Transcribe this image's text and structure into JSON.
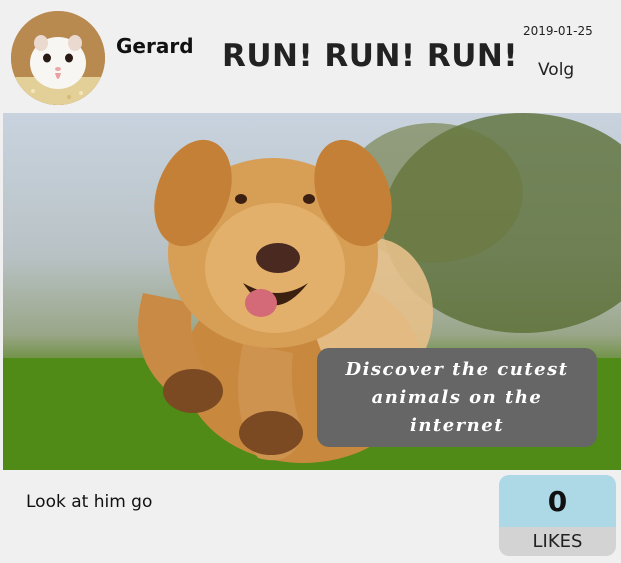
{
  "post": {
    "username": "Gerard",
    "title": "RUN! RUN! RUN!",
    "date": "2019-01-25",
    "follow_label": "Volg",
    "promo_text": "Discover the cutest animals on the internet",
    "caption": "Look at him go",
    "likes_count": "0",
    "likes_label": "LIKES"
  },
  "colors": {
    "card_background": "#f0f0f0",
    "promo_background": "#666666",
    "likes_count_background": "#add8e6",
    "likes_label_background": "#d3d3d3"
  },
  "icons": {
    "avatar": "hamster-avatar",
    "photo": "golden-retriever-running-photo"
  }
}
